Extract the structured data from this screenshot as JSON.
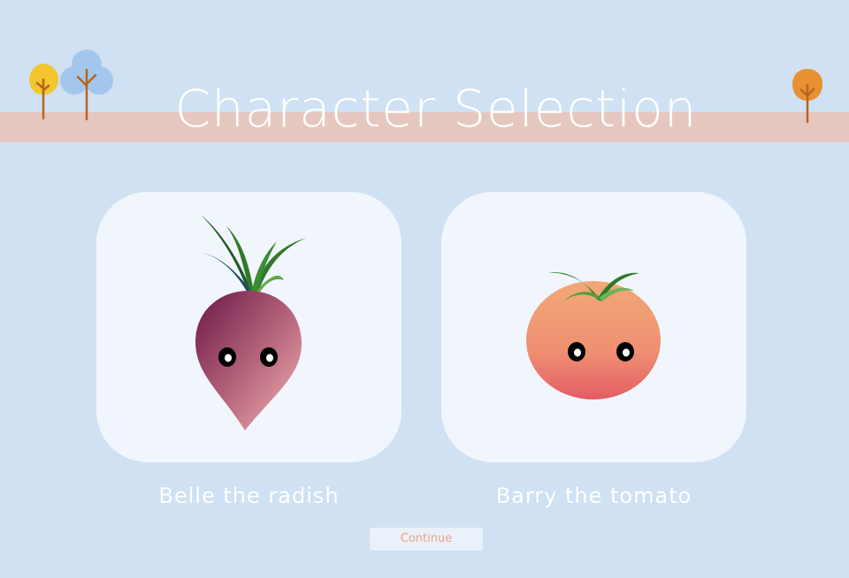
{
  "title": "Character Selection",
  "characters": [
    {
      "id": "radish",
      "label": "Belle the radish",
      "icon": "radish-icon"
    },
    {
      "id": "tomato",
      "label": "Barry the tomato",
      "icon": "tomato-icon"
    }
  ],
  "continue_label": "Continue",
  "colors": {
    "background": "#cfe1f2",
    "ground_band": "#e6c7bf",
    "card": "#f1f6fc",
    "title_text": "#ffffff",
    "continue_text": "#efa07f",
    "continue_bg": "#e9f1fa",
    "tree_yellow": "#f3c62f",
    "tree_blue": "#a3c7ec",
    "tree_orange": "#e89032",
    "trunk": "#b8651f"
  }
}
